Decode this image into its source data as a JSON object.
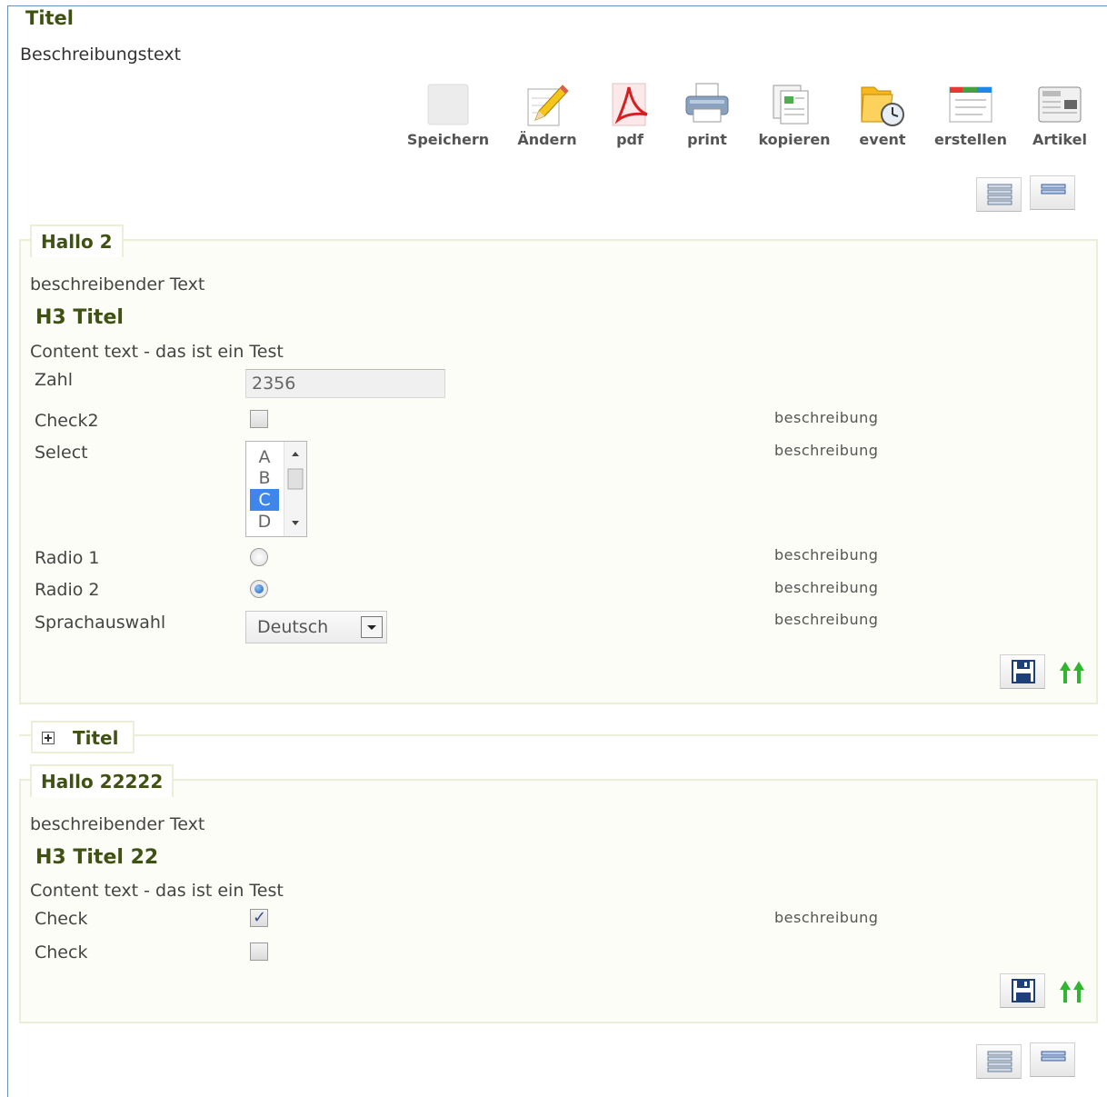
{
  "page": {
    "title": "Titel",
    "description": "Beschreibungstext"
  },
  "toolbar": [
    {
      "label": "Speichern",
      "icon": "save-icon"
    },
    {
      "label": "Ändern",
      "icon": "pencil-edit-icon"
    },
    {
      "label": "pdf",
      "icon": "pdf-icon"
    },
    {
      "label": "print",
      "icon": "printer-icon"
    },
    {
      "label": "kopieren",
      "icon": "copy-documents-icon"
    },
    {
      "label": "event",
      "icon": "folder-clock-icon"
    },
    {
      "label": "erstellen",
      "icon": "create-document-icon"
    },
    {
      "label": "Artikel",
      "icon": "newspaper-icon"
    }
  ],
  "view_buttons": [
    "list-expanded-icon",
    "list-compact-icon"
  ],
  "section1": {
    "legend": "Hallo 2",
    "description": "beschreibender Text",
    "h3": "H3 Titel",
    "content": "Content text - das ist ein Test",
    "fields": {
      "zahl": {
        "label": "Zahl",
        "value": "2356"
      },
      "check2": {
        "label": "Check2",
        "checked": false,
        "desc": "beschreibung"
      },
      "select": {
        "label": "Select",
        "options": [
          "A",
          "B",
          "C",
          "D"
        ],
        "selected": "C",
        "desc": "beschreibung"
      },
      "radio1": {
        "label": "Radio 1",
        "checked": false,
        "desc": "beschreibung"
      },
      "radio2": {
        "label": "Radio 2",
        "checked": true,
        "desc": "beschreibung"
      },
      "sprache": {
        "label": "Sprachauswahl",
        "value": "Deutsch",
        "desc": "beschreibung"
      }
    }
  },
  "collapsed": {
    "legend": "Titel"
  },
  "section2": {
    "legend": "Hallo 22222",
    "description": "beschreibender Text",
    "h3": "H3 Titel 22",
    "content": "Content text - das ist ein Test",
    "fields": {
      "check_a": {
        "label": "Check",
        "checked": true,
        "desc": "beschreibung"
      },
      "check_b": {
        "label": "Check",
        "checked": false
      }
    }
  },
  "colors": {
    "accent_green": "#3f5213",
    "border": "#ecefd8",
    "selection": "#3f86ea",
    "arrow_green": "#2fb52f"
  }
}
